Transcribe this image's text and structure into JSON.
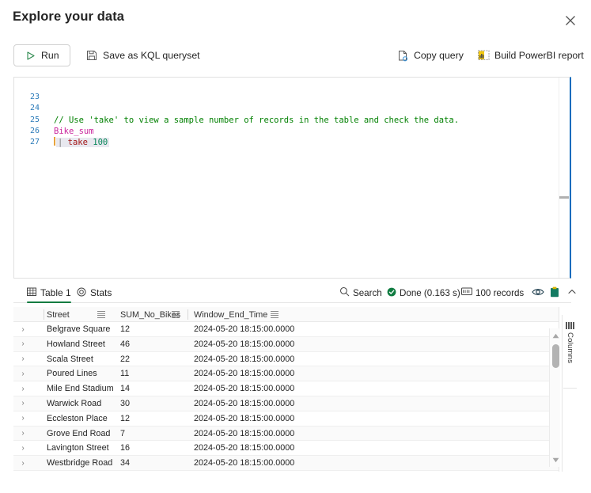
{
  "dialog": {
    "title": "Explore your data",
    "close_icon": "close-icon"
  },
  "command_bar": {
    "run": {
      "label": "Run",
      "icon": "play-triangle-icon"
    },
    "save_queryset": {
      "label": "Save as KQL queryset",
      "icon": "save-floppy-icon"
    },
    "copy_query": {
      "label": "Copy query",
      "icon": "copy-document-icon"
    },
    "build_powerbi": {
      "label": "Build PowerBI report",
      "icon": "powerbi-report-icon"
    }
  },
  "editor": {
    "language": "KQL",
    "focus_accent": "#0f6cbd",
    "lines": [
      {
        "number": "23",
        "segments": []
      },
      {
        "number": "24",
        "segments": [
          {
            "text": "// Use 'take' to view a sample number of records in the table and check the data.",
            "type": "comment"
          }
        ]
      },
      {
        "number": "25",
        "segments": [
          {
            "text": "Bike_sum",
            "type": "table"
          }
        ]
      },
      {
        "number": "26",
        "segments": [
          {
            "text": "| ",
            "type": "op"
          },
          {
            "text": "take",
            "type": "keyword"
          },
          {
            "text": " ",
            "type": "plain"
          },
          {
            "text": "100",
            "type": "number"
          }
        ],
        "selected": true,
        "cursor": true
      },
      {
        "number": "27",
        "segments": []
      }
    ]
  },
  "results": {
    "tabs": [
      {
        "label": "Table 1",
        "icon": "table-grid-icon",
        "active": true
      },
      {
        "label": "Stats",
        "icon": "stats-target-icon",
        "active": false
      }
    ],
    "toolbar": {
      "search": {
        "label": "Search",
        "icon": "search-icon"
      },
      "status": {
        "label": "Done (0.163 s)",
        "icon": "success-check-icon",
        "color": "#107c41"
      },
      "records": {
        "label": "100 records",
        "icon": "records-count-icon"
      },
      "preview_icon": "eye-icon",
      "copy_icon": "clipboard-icon",
      "collapse_icon": "chevron-up-icon"
    },
    "grid": {
      "columns": [
        {
          "key": "street",
          "label": "Street",
          "menu_icon": "column-menu-icon"
        },
        {
          "key": "bikes",
          "label": "SUM_No_Bikes",
          "menu_icon": "column-menu-icon"
        },
        {
          "key": "time",
          "label": "Window_End_Time",
          "menu_icon": "column-menu-icon"
        }
      ],
      "rows": [
        {
          "expand_icon": "chevron-right-icon",
          "street": "Belgrave Square",
          "bikes": "12",
          "time": "2024-05-20 18:15:00.0000"
        },
        {
          "expand_icon": "chevron-right-icon",
          "street": "Howland Street",
          "bikes": "46",
          "time": "2024-05-20 18:15:00.0000"
        },
        {
          "expand_icon": "chevron-right-icon",
          "street": "Scala Street",
          "bikes": "22",
          "time": "2024-05-20 18:15:00.0000"
        },
        {
          "expand_icon": "chevron-right-icon",
          "street": "Poured Lines",
          "bikes": "11",
          "time": "2024-05-20 18:15:00.0000"
        },
        {
          "expand_icon": "chevron-right-icon",
          "street": "Mile End Stadium",
          "bikes": "14",
          "time": "2024-05-20 18:15:00.0000"
        },
        {
          "expand_icon": "chevron-right-icon",
          "street": "Warwick Road",
          "bikes": "30",
          "time": "2024-05-20 18:15:00.0000"
        },
        {
          "expand_icon": "chevron-right-icon",
          "street": "Eccleston Place",
          "bikes": "12",
          "time": "2024-05-20 18:15:00.0000"
        },
        {
          "expand_icon": "chevron-right-icon",
          "street": "Grove End Road",
          "bikes": "7",
          "time": "2024-05-20 18:15:00.0000"
        },
        {
          "expand_icon": "chevron-right-icon",
          "street": "Lavington Street",
          "bikes": "16",
          "time": "2024-05-20 18:15:00.0000"
        },
        {
          "expand_icon": "chevron-right-icon",
          "street": "Westbridge Road",
          "bikes": "34",
          "time": "2024-05-20 18:15:00.0000"
        }
      ]
    },
    "columns_rail": {
      "label": "Columns",
      "icon": "columns-icon"
    },
    "scrollbar": {
      "up_icon": "scroll-up-arrow-icon",
      "down_icon": "scroll-down-arrow-icon"
    }
  }
}
